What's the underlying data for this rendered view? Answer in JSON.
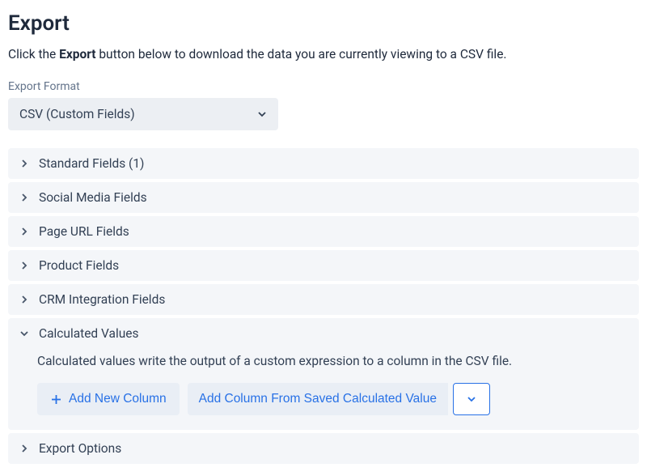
{
  "title": "Export",
  "description_pre": "Click the ",
  "description_bold": "Export",
  "description_post": " button below to download the data you are currently viewing to a CSV file.",
  "format": {
    "label": "Export Format",
    "value": "CSV (Custom Fields)"
  },
  "sections": {
    "standard": {
      "label": "Standard Fields (1)"
    },
    "social": {
      "label": "Social Media Fields"
    },
    "pageurl": {
      "label": "Page URL Fields"
    },
    "product": {
      "label": "Product Fields"
    },
    "crm": {
      "label": "CRM Integration Fields"
    },
    "calculated": {
      "label": "Calculated Values",
      "description": "Calculated values write the output of a custom expression to a column in the CSV file.",
      "add_new": "Add New Column",
      "add_saved": "Add Column From Saved Calculated Value"
    },
    "options": {
      "label": "Export Options"
    }
  }
}
